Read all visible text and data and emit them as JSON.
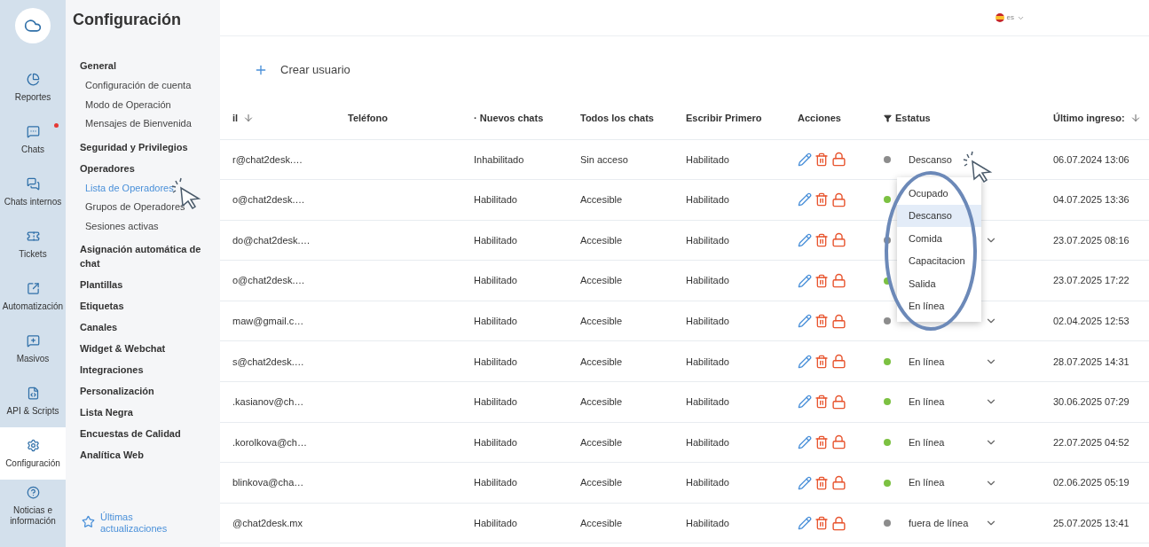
{
  "rail": {
    "items": [
      {
        "label": "Reportes",
        "selected": false,
        "notification": false
      },
      {
        "label": "Chats",
        "selected": false,
        "notification": true
      },
      {
        "label": "Chats internos",
        "selected": false,
        "notification": false
      },
      {
        "label": "Tickets",
        "selected": false,
        "notification": false
      },
      {
        "label": "Automatización",
        "selected": false,
        "notification": false
      },
      {
        "label": "Masivos",
        "selected": false,
        "notification": false
      },
      {
        "label": "API & Scripts",
        "selected": false,
        "notification": false
      },
      {
        "label": "Configuración",
        "selected": true,
        "notification": false
      },
      {
        "label": "Noticias e información",
        "selected": false,
        "notification": false
      }
    ]
  },
  "settings": {
    "title": "Configuración",
    "sections": [
      {
        "label": "General",
        "children": [
          {
            "label": "Configuración de cuenta",
            "selected": false
          },
          {
            "label": "Modo de Operación",
            "selected": false
          },
          {
            "label": "Mensajes de Bienvenida",
            "selected": false
          }
        ]
      },
      {
        "label": "Seguridad y Privilegios"
      },
      {
        "label": "Operadores",
        "children": [
          {
            "label": "Lista de Operadores",
            "selected": true
          },
          {
            "label": "Grupos de Operadores",
            "selected": false
          },
          {
            "label": "Sesiones activas",
            "selected": false
          }
        ]
      },
      {
        "label": "Asignación automática de chat"
      },
      {
        "label": "Plantillas"
      },
      {
        "label": "Etiquetas"
      },
      {
        "label": "Canales"
      },
      {
        "label": "Widget & Webchat"
      },
      {
        "label": "Integraciones"
      },
      {
        "label": "Personalización"
      },
      {
        "label": "Lista Negra"
      },
      {
        "label": "Encuestas de Calidad"
      },
      {
        "label": "Analítica Web"
      }
    ],
    "updates_link": "Últimas actualizaciones"
  },
  "language": {
    "code": "es"
  },
  "create_button": "Crear usuario",
  "table": {
    "columns": [
      {
        "label": "il",
        "sort": true
      },
      {
        "label": "Teléfono",
        "sort": false
      },
      {
        "label": "· Nuevos chats",
        "sort": false
      },
      {
        "label": "Todos los chats",
        "sort": false
      },
      {
        "label": "Escribir Primero",
        "sort": false
      },
      {
        "label": "Acciones",
        "sort": false
      },
      {
        "label": "Estatus",
        "sort": false,
        "filter": true
      },
      {
        "label": "Último ingreso:",
        "sort": true
      }
    ],
    "rows": [
      {
        "email": "r@chat2desk.…",
        "new_chats": "Inhabilitado",
        "all_chats": "Sin acceso",
        "write_first": "Habilitado",
        "status": {
          "color": "#8c8c8c",
          "text": "Descanso",
          "caret": false
        },
        "last_login": "06.07.2024 13:06"
      },
      {
        "email": "o@chat2desk.…",
        "new_chats": "Habilitado",
        "all_chats": "Accesible",
        "write_first": "Habilitado",
        "status": {
          "color": "#7cc142",
          "caret": false
        },
        "last_login": "04.07.2025 13:36"
      },
      {
        "email": "do@chat2desk.…",
        "new_chats": "Habilitado",
        "all_chats": "Accesible",
        "write_first": "Habilitado",
        "status": {
          "color": "#8c8c8c",
          "caret": true
        },
        "last_login": "23.07.2025 08:16"
      },
      {
        "email": "o@chat2desk.…",
        "new_chats": "Habilitado",
        "all_chats": "Accesible",
        "write_first": "Habilitado",
        "status": {
          "color": "#7cc142",
          "caret": false
        },
        "last_login": "23.07.2025 17:22"
      },
      {
        "email": "maw@gmail.c…",
        "new_chats": "Habilitado",
        "all_chats": "Accesible",
        "write_first": "Habilitado",
        "status": {
          "color": "#8c8c8c",
          "caret": true
        },
        "last_login": "02.04.2025 12:53"
      },
      {
        "email": "s@chat2desk.…",
        "new_chats": "Habilitado",
        "all_chats": "Accesible",
        "write_first": "Habilitado",
        "status": {
          "color": "#7cc142",
          "text": "En línea",
          "caret": true
        },
        "last_login": "28.07.2025 14:31"
      },
      {
        "email": ".kasianov@ch…",
        "new_chats": "Habilitado",
        "all_chats": "Accesible",
        "write_first": "Habilitado",
        "status": {
          "color": "#7cc142",
          "text": "En línea",
          "caret": true
        },
        "last_login": "30.06.2025 07:29"
      },
      {
        "email": ".korolkova@ch…",
        "new_chats": "Habilitado",
        "all_chats": "Accesible",
        "write_first": "Habilitado",
        "status": {
          "color": "#7cc142",
          "text": "En línea",
          "caret": true
        },
        "last_login": "22.07.2025 04:52"
      },
      {
        "email": "blinkova@cha…",
        "new_chats": "Habilitado",
        "all_chats": "Accesible",
        "write_first": "Habilitado",
        "status": {
          "color": "#7cc142",
          "text": "En línea",
          "caret": true
        },
        "last_login": "02.06.2025 05:19"
      },
      {
        "email": "@chat2desk.mx",
        "new_chats": "Habilitado",
        "all_chats": "Accesible",
        "write_first": "Habilitado",
        "status": {
          "color": "#8c8c8c",
          "text": "fuera de línea",
          "caret": true
        },
        "last_login": "25.07.2025 13:41"
      }
    ]
  },
  "status_menu": {
    "options": [
      {
        "label": "Ocupado",
        "selected": false
      },
      {
        "label": "Descanso",
        "selected": true
      },
      {
        "label": "Comida",
        "selected": false
      },
      {
        "label": "Capacitacion",
        "selected": false
      },
      {
        "label": "Salida",
        "selected": false
      },
      {
        "label": "En línea",
        "selected": false
      }
    ]
  }
}
